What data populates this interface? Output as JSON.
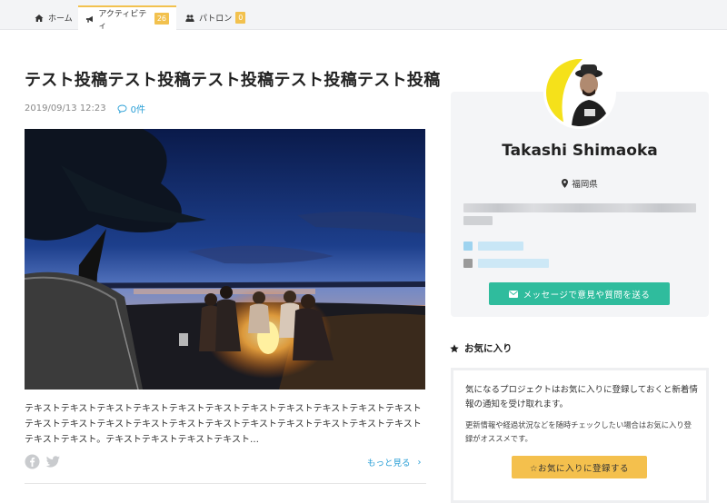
{
  "tabs": [
    {
      "label": "ホーム",
      "icon": "home-icon"
    },
    {
      "label": "アクティビティ",
      "icon": "megaphone-icon",
      "badge": "26"
    },
    {
      "label": "パトロン",
      "icon": "users-icon",
      "badge": "0"
    }
  ],
  "post": {
    "title": "テスト投稿テスト投稿テスト投稿テスト投稿テスト投稿",
    "date": "2019/09/13 12:23",
    "comments": "0件",
    "excerpt": "テキストテキストテキストテキストテキストテキストテキストテキストテキストテキストテキストテキストテキストテキストテキストテキストテキストテキストテキストテキストテキストテキストテキストテキスト。テキストテキストテキストテキスト…",
    "more_label": "もっと見る",
    "share_icons": [
      "facebook-icon",
      "twitter-icon"
    ]
  },
  "profile": {
    "name": "Takashi Shimaoka",
    "location": "福岡県",
    "message_button": "メッセージで意見や質問を送る"
  },
  "favorites": {
    "heading": "お気に入り",
    "text1": "気になるプロジェクトはお気に入りに登録しておくと新着情報の通知を受け取れます。",
    "text2": "更新情報や経過状況などを随時チェックしたい場合はお気に入り登録がオススメです。",
    "button": "☆お気に入りに登録する"
  },
  "colors": {
    "accent_yellow": "#f2c14e",
    "link_blue": "#2a9fd6",
    "teal_button": "#2fbc9d"
  }
}
